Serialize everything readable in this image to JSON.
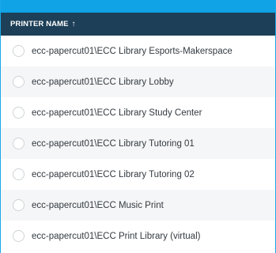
{
  "header": {
    "column_label": "PRINTER NAME",
    "sort_icon": "arrow-up-icon",
    "sort_glyph": "🡑"
  },
  "colors": {
    "accent": "#10a3e6",
    "header_bg": "#1d3f57"
  },
  "printers": [
    {
      "label": "ecc-papercut01\\ECC Library Esports-Makerspace"
    },
    {
      "label": "ecc-papercut01\\ECC Library Lobby"
    },
    {
      "label": "ecc-papercut01\\ECC Library Study Center"
    },
    {
      "label": "ecc-papercut01\\ECC Library Tutoring 01"
    },
    {
      "label": "ecc-papercut01\\ECC Library Tutoring 02"
    },
    {
      "label": "ecc-papercut01\\ECC Music Print"
    },
    {
      "label": "ecc-papercut01\\ECC Print Library (virtual)"
    }
  ]
}
